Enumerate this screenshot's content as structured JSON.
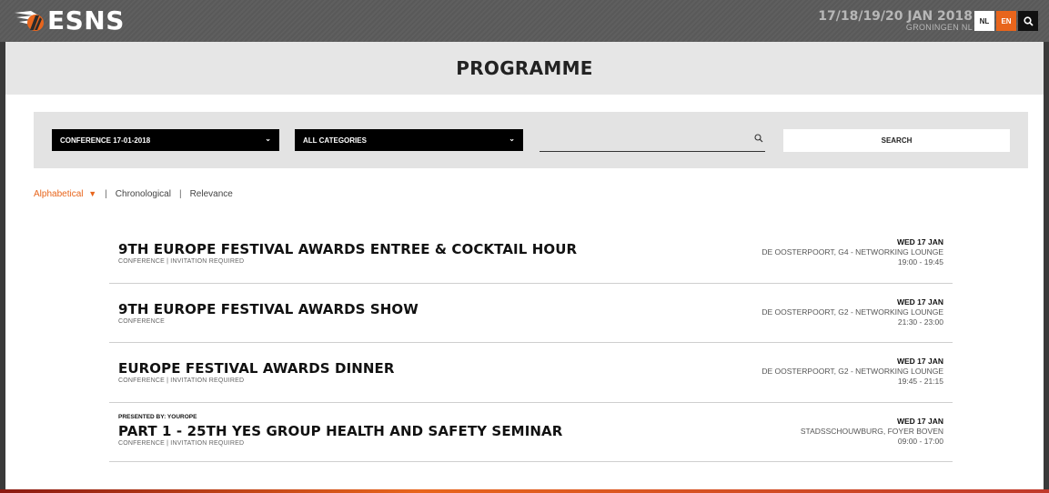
{
  "header": {
    "logo_text": "ESNS",
    "dates": "17/18/19/20 JAN 2018",
    "location": "GRONINGEN NL",
    "lang_nl": "NL",
    "lang_en": "EN",
    "active_lang": "EN",
    "search_icon": "search-icon",
    "accent_color": "#e8651c"
  },
  "page": {
    "title": "PROGRAMME"
  },
  "filters": {
    "day_select": "CONFERENCE 17-01-2018",
    "category_select": "ALL CATEGORIES",
    "search_value": "",
    "search_button": "SEARCH"
  },
  "sort": {
    "options": [
      "Alphabetical",
      "Chronological",
      "Relevance"
    ],
    "active": "Alphabetical",
    "separator": "|"
  },
  "events": [
    {
      "presenter": "",
      "title": "9TH EUROPE FESTIVAL AWARDS ENTREE & COCKTAIL HOUR",
      "meta": "CONFERENCE | INVITATION REQUIRED",
      "day": "WED 17 JAN",
      "venue": "DE OOSTERPOORT, G4 - NETWORKING LOUNGE",
      "time": "19:00 - 19:45"
    },
    {
      "presenter": "",
      "title": "9TH EUROPE FESTIVAL AWARDS SHOW",
      "meta": "CONFERENCE",
      "day": "WED 17 JAN",
      "venue": "DE OOSTERPOORT, G2 - NETWORKING LOUNGE",
      "time": "21:30 - 23:00"
    },
    {
      "presenter": "",
      "title": "EUROPE FESTIVAL AWARDS DINNER",
      "meta": "CONFERENCE | INVITATION REQUIRED",
      "day": "WED 17 JAN",
      "venue": "DE OOSTERPOORT, G2 - NETWORKING LOUNGE",
      "time": "19:45 - 21:15"
    },
    {
      "presenter": "PRESENTED BY: YOUROPE",
      "title": "PART 1 - 25TH YES GROUP HEALTH AND SAFETY SEMINAR",
      "meta": "CONFERENCE | INVITATION REQUIRED",
      "day": "WED 17 JAN",
      "venue": "STADSSCHOUWBURG, FOYER BOVEN",
      "time": "09:00 - 17:00"
    }
  ]
}
